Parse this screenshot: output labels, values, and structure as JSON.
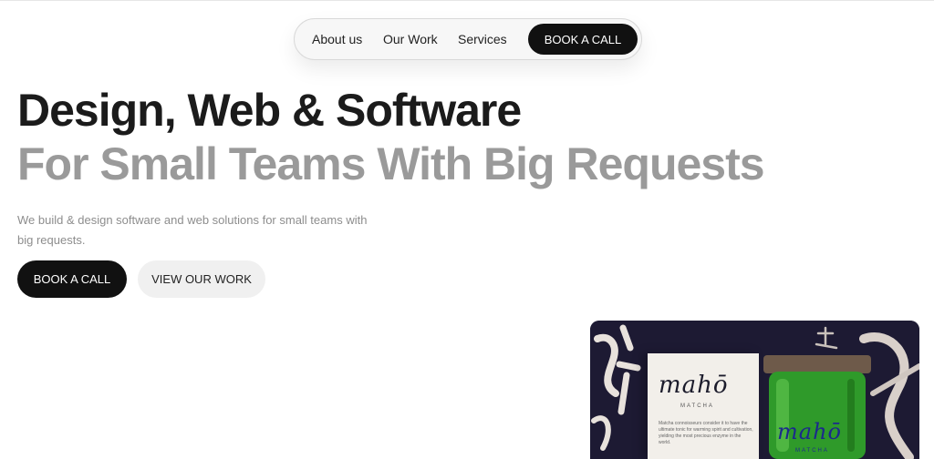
{
  "nav": {
    "links": [
      {
        "label": "About us"
      },
      {
        "label": "Our Work"
      },
      {
        "label": "Services"
      }
    ],
    "cta_label": "BOOK A CALL"
  },
  "hero": {
    "title_line1": "Design, Web & Software",
    "title_line2": "For Small Teams With Big Requests",
    "description": "We build & design software and web solutions for small teams with big requests.",
    "primary_button": "BOOK A CALL",
    "secondary_button": "VIEW OUR WORK"
  },
  "showcase": {
    "box_logo": "mahō",
    "box_subtitle": "MATCHA",
    "box_body": "Matcha connoisseurs consider it to have the ultimate tonic for warming spirit and cultivation, yielding the most precious enzyme in the world.",
    "jar_logo": "mahō",
    "jar_subtitle": "MATCHA"
  },
  "colors": {
    "title_dark": "#1b1b1b",
    "title_gray": "#9a9a9a",
    "button_dark": "#111111",
    "button_light": "#f0f0f0",
    "jar_green": "#2f9a2a",
    "card_bg": "#1d1a33"
  }
}
